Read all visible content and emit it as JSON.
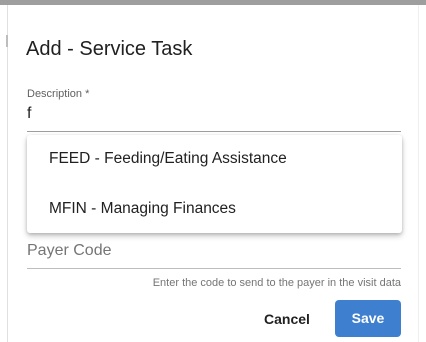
{
  "dialog": {
    "title": "Add - Service Task",
    "description": {
      "label": "Description *",
      "value": "f"
    },
    "suggestions": [
      {
        "label": "FEED - Feeding/Eating Assistance"
      },
      {
        "label": "MFIN - Managing Finances"
      }
    ],
    "payer_code": {
      "placeholder": "Payer Code",
      "hint": "Enter the code to send to the payer in the visit data"
    },
    "buttons": {
      "cancel": "Cancel",
      "save": "Save"
    }
  },
  "colors": {
    "primary": "#3f7fd0",
    "text": "#212121",
    "muted": "#757575"
  }
}
